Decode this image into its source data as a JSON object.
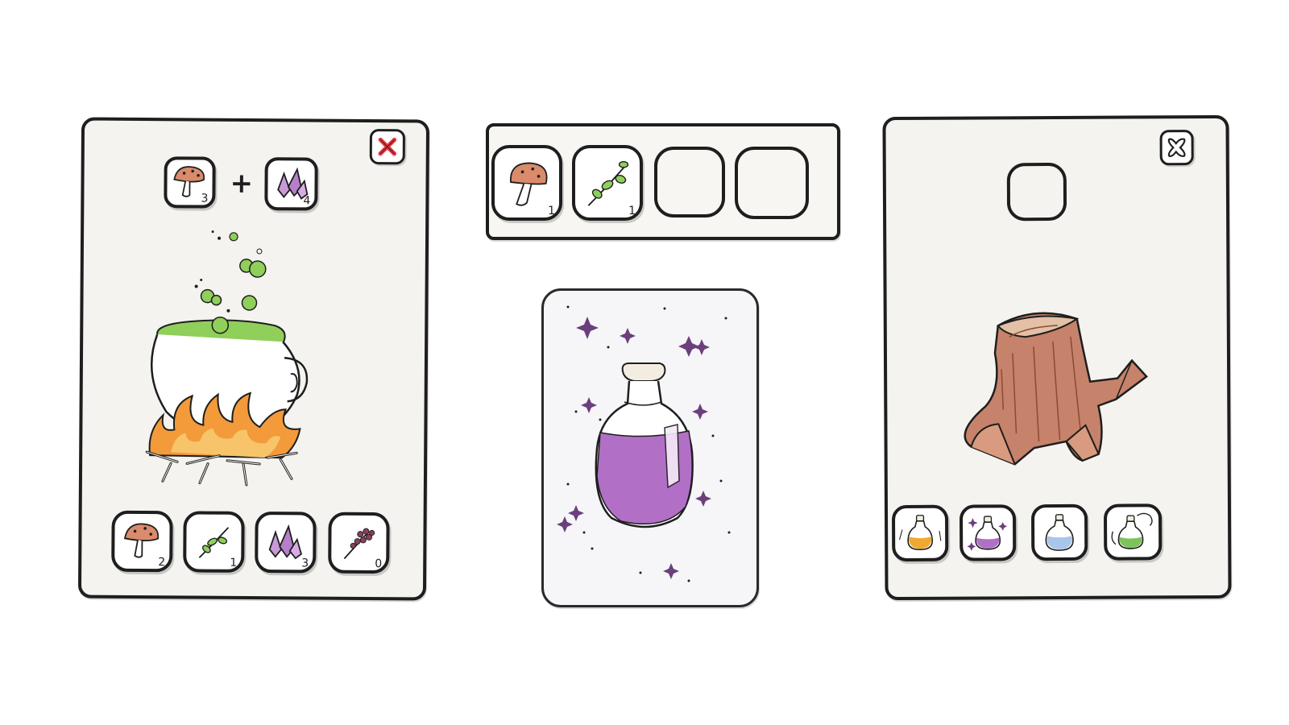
{
  "cauldron_panel": {
    "recipe": {
      "ingredient_1": {
        "icon": "mushroom-icon",
        "count": "3"
      },
      "operator": "+",
      "ingredient_2": {
        "icon": "crystal-icon",
        "count": "4"
      }
    },
    "close_icon": "close-icon",
    "inventory": [
      {
        "icon": "mushroom-icon",
        "count": "2"
      },
      {
        "icon": "herb-sprig-icon",
        "count": "1"
      },
      {
        "icon": "crystal-icon",
        "count": "3"
      },
      {
        "icon": "berry-branch-icon",
        "count": "0"
      }
    ],
    "colors": {
      "close": "#e8323c",
      "potion": "#8fcf5a",
      "flame": "#f39a3b"
    }
  },
  "inventory_bar": {
    "slots": [
      {
        "icon": "mushroom-icon",
        "count": "1"
      },
      {
        "icon": "herb-sprig-icon",
        "count": "1"
      },
      {
        "icon": "empty-slot",
        "count": ""
      },
      {
        "icon": "empty-slot",
        "count": ""
      }
    ]
  },
  "potion_card": {
    "icon": "purple-potion-bottle-icon",
    "color": "#b26fc6"
  },
  "stump_panel": {
    "close_icon": "close-icon",
    "drop_slot_icon": "empty-slot",
    "potions": [
      {
        "icon": "orange-potion-icon",
        "color": "#f0a930"
      },
      {
        "icon": "purple-potion-icon",
        "color": "#b26fc6"
      },
      {
        "icon": "blue-potion-icon",
        "color": "#a9c6ea"
      },
      {
        "icon": "green-potion-icon",
        "color": "#7cc35b"
      }
    ]
  }
}
